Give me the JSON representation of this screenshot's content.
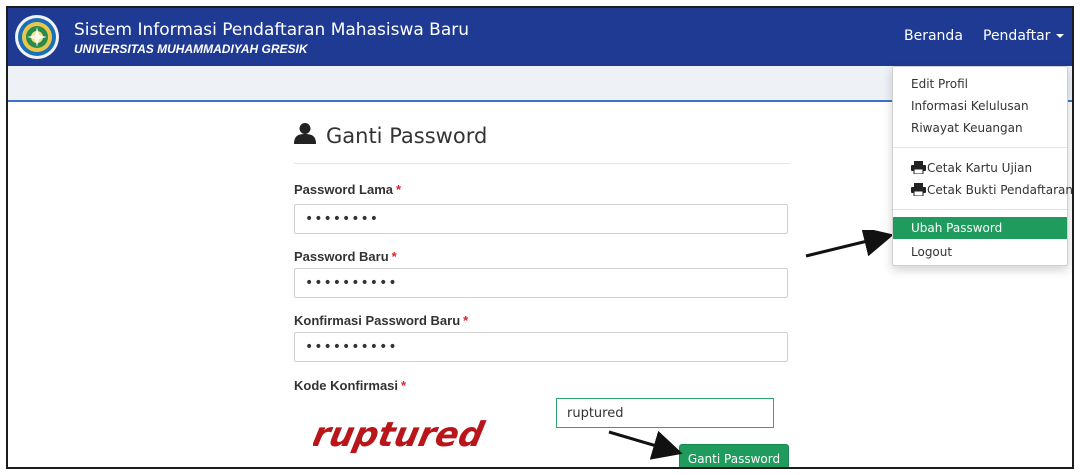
{
  "header": {
    "title": "Sistem Informasi Pendaftaran Mahasiswa Baru",
    "subtitle": "UNIVERSITAS MUHAMMADIYAH GRESIK",
    "nav": {
      "home": "Beranda",
      "registrant": "Pendaftar"
    },
    "logo_icon": "university-seal-icon"
  },
  "dropdown": {
    "items": [
      {
        "label": "Edit Profil"
      },
      {
        "label": "Informasi Kelulusan"
      },
      {
        "label": "Riwayat Keuangan"
      },
      {
        "label": "Cetak Kartu Ujian",
        "icon": "printer-icon"
      },
      {
        "label": "Cetak Bukti Pendaftaran",
        "icon": "printer-icon"
      },
      {
        "label": "Ubah Password",
        "active": true
      },
      {
        "label": "Logout"
      }
    ]
  },
  "form": {
    "title": "Ganti Password",
    "title_icon": "user-icon",
    "required_mark": "*",
    "fields": [
      {
        "label": "Password Lama",
        "value": "••••••••"
      },
      {
        "label": "Password Baru",
        "value": "••••••••••"
      },
      {
        "label": "Konfirmasi Password Baru",
        "value": "••••••••••"
      }
    ],
    "captcha": {
      "label": "Kode Konfirmasi",
      "image_text": "ruptured",
      "input_value": "ruptured"
    },
    "submit_label": "Ganti Password"
  },
  "colors": {
    "navbar": "#1f3a93",
    "accent_green": "#1e9b5d",
    "required": "#d9232d",
    "captcha_text": "#b8161a"
  }
}
